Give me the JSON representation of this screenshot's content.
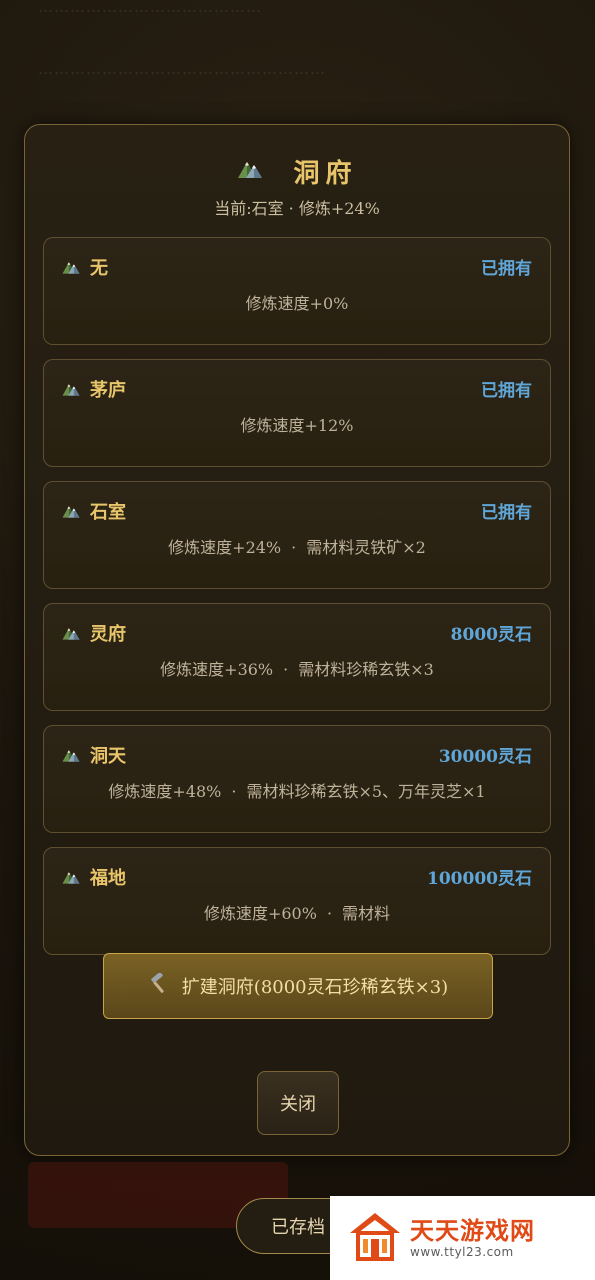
{
  "background": {
    "text_top": "……………………………………",
    "text_mid": "………………………………………………"
  },
  "modal": {
    "title": "洞府",
    "subtitle": "当前:石室 · 修炼+24%",
    "items": [
      {
        "name": "无",
        "status": "已拥有",
        "effect": "修炼速度+0%",
        "materials": ""
      },
      {
        "name": "茅庐",
        "status": "已拥有",
        "effect": "修炼速度+12%",
        "materials": ""
      },
      {
        "name": "石室",
        "status": "已拥有",
        "effect": "修炼速度+24%",
        "materials": "需材料灵铁矿×2"
      },
      {
        "name": "灵府",
        "status": "8000灵石",
        "effect": "修炼速度+36%",
        "materials": "需材料珍稀玄铁×3"
      },
      {
        "name": "洞天",
        "status": "30000灵石",
        "effect": "修炼速度+48%",
        "materials": "需材料珍稀玄铁×5、万年灵芝×1"
      },
      {
        "name": "福地",
        "status": "100000灵石",
        "effect": "修炼速度+60%",
        "materials": "需材料"
      }
    ],
    "expand_button": "扩建洞府(8000灵石珍稀玄铁×3)",
    "close_button": "关闭"
  },
  "bottom": {
    "saved_button": "已存档"
  },
  "watermark": {
    "title": "天天游戏网",
    "url": "www.ttyl23.com"
  },
  "colors": {
    "gold": "#e8c46a",
    "status_blue": "#5fa6d9",
    "panel_bg": "#231c11",
    "border": "#7a6436",
    "watermark_orange": "#e04a16"
  },
  "icons": {
    "item_icon": "mountain-icon",
    "expand_icon": "hammer-icon"
  }
}
